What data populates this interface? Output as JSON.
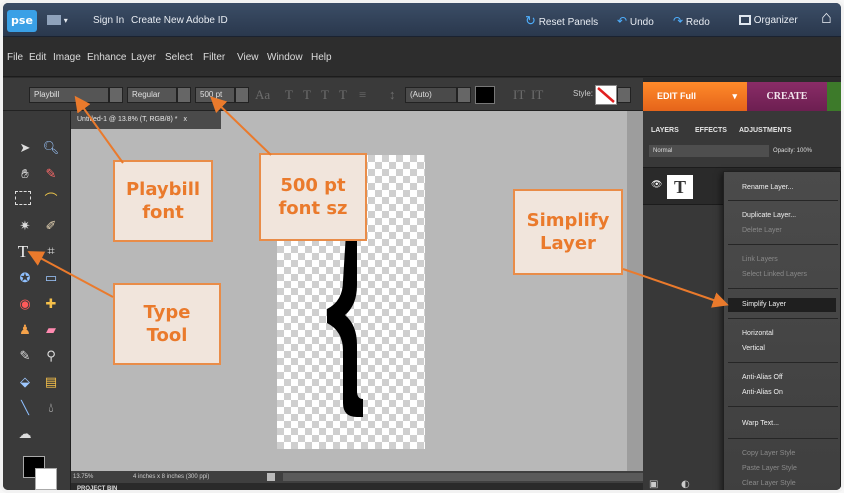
{
  "app": {
    "logo": "pse"
  },
  "topbar": {
    "sign_in": "Sign In",
    "create_id": "Create New Adobe ID",
    "reset_panels": "Reset Panels",
    "undo": "Undo",
    "redo": "Redo",
    "organizer": "Organizer"
  },
  "menu": {
    "items": [
      "File",
      "Edit",
      "Image",
      "Enhance",
      "Layer",
      "Select",
      "Filter",
      "View",
      "Window",
      "Help"
    ]
  },
  "options": {
    "font": "Playbill",
    "style": "Regular",
    "size": "500 pt",
    "leading": "(Auto)",
    "style_label": "Style:"
  },
  "modes": {
    "edit": "EDIT Full",
    "create": "CREATE"
  },
  "document": {
    "tab": "Untitled-1 @ 13.8% (T, RGB/8) *",
    "close": "x"
  },
  "status": {
    "zoom": "13.75%",
    "size": "4 inches x 8 inches (300 ppi)"
  },
  "project_bin": "PROJECT BIN",
  "panel": {
    "tabs": [
      "LAYERS",
      "EFFECTS",
      "ADJUSTMENTS"
    ],
    "blend": "Normal",
    "opacity": "Opacity: 100%",
    "layer_thumb": "T"
  },
  "context_menu": {
    "items": [
      {
        "label": "Rename Layer...",
        "disabled": false
      },
      {
        "label": "Duplicate Layer...",
        "disabled": false
      },
      {
        "label": "Delete Layer",
        "disabled": true
      },
      {
        "label": "Link Layers",
        "disabled": true
      },
      {
        "label": "Select Linked Layers",
        "disabled": true
      },
      {
        "label": "Simplify Layer",
        "disabled": false,
        "highlight": true
      },
      {
        "label": "Horizontal",
        "disabled": false
      },
      {
        "label": "Vertical",
        "disabled": false
      },
      {
        "label": "Anti-Alias Off",
        "disabled": false
      },
      {
        "label": "Anti-Alias On",
        "disabled": false
      },
      {
        "label": "Warp Text...",
        "disabled": false
      },
      {
        "label": "Copy Layer Style",
        "disabled": true
      },
      {
        "label": "Paste Layer Style",
        "disabled": true
      },
      {
        "label": "Clear Layer Style",
        "disabled": true
      }
    ]
  },
  "callouts": {
    "playbill": "Playbill\nfont",
    "size": "500 pt\nfont sz",
    "simplify": "Simplify\nLayer",
    "type_tool": "Type\nTool"
  },
  "colors": {
    "accent": "#e98c48",
    "callout_bg": "#f1e5dc",
    "edit_tab": "#ff8a2a",
    "create_tab": "#7a2559"
  }
}
